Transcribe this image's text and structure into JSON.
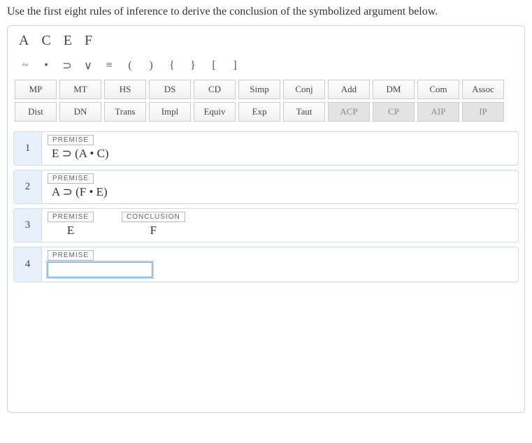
{
  "instruction": "Use the first eight rules of inference to derive the conclusion of the symbolized argument below.",
  "variables": [
    "A",
    "C",
    "E",
    "F"
  ],
  "symbols": [
    "~",
    "•",
    "⊃",
    "∨",
    "≡",
    "(",
    ")",
    "{",
    "}",
    "[",
    "]"
  ],
  "rules_row1": [
    "MP",
    "MT",
    "HS",
    "DS",
    "CD",
    "Simp",
    "Conj",
    "Add",
    "DM",
    "Com",
    "Assoc"
  ],
  "rules_row2": [
    "Dist",
    "DN",
    "Trans",
    "Impl",
    "Equiv",
    "Exp",
    "Taut",
    "ACP",
    "CP",
    "AIP",
    "IP"
  ],
  "disabled_rules": [
    "ACP",
    "CP",
    "AIP",
    "IP"
  ],
  "lines": {
    "1": {
      "tag": "PREMISE",
      "formula": "E ⊃ (A • C)"
    },
    "2": {
      "tag": "PREMISE",
      "formula": "A ⊃ (F • E)"
    },
    "3": {
      "tag": "PREMISE",
      "formula": "E",
      "concl_tag": "CONCLUSION",
      "concl_formula": "F"
    },
    "4": {
      "tag": "PREMISE",
      "input_value": ""
    }
  }
}
